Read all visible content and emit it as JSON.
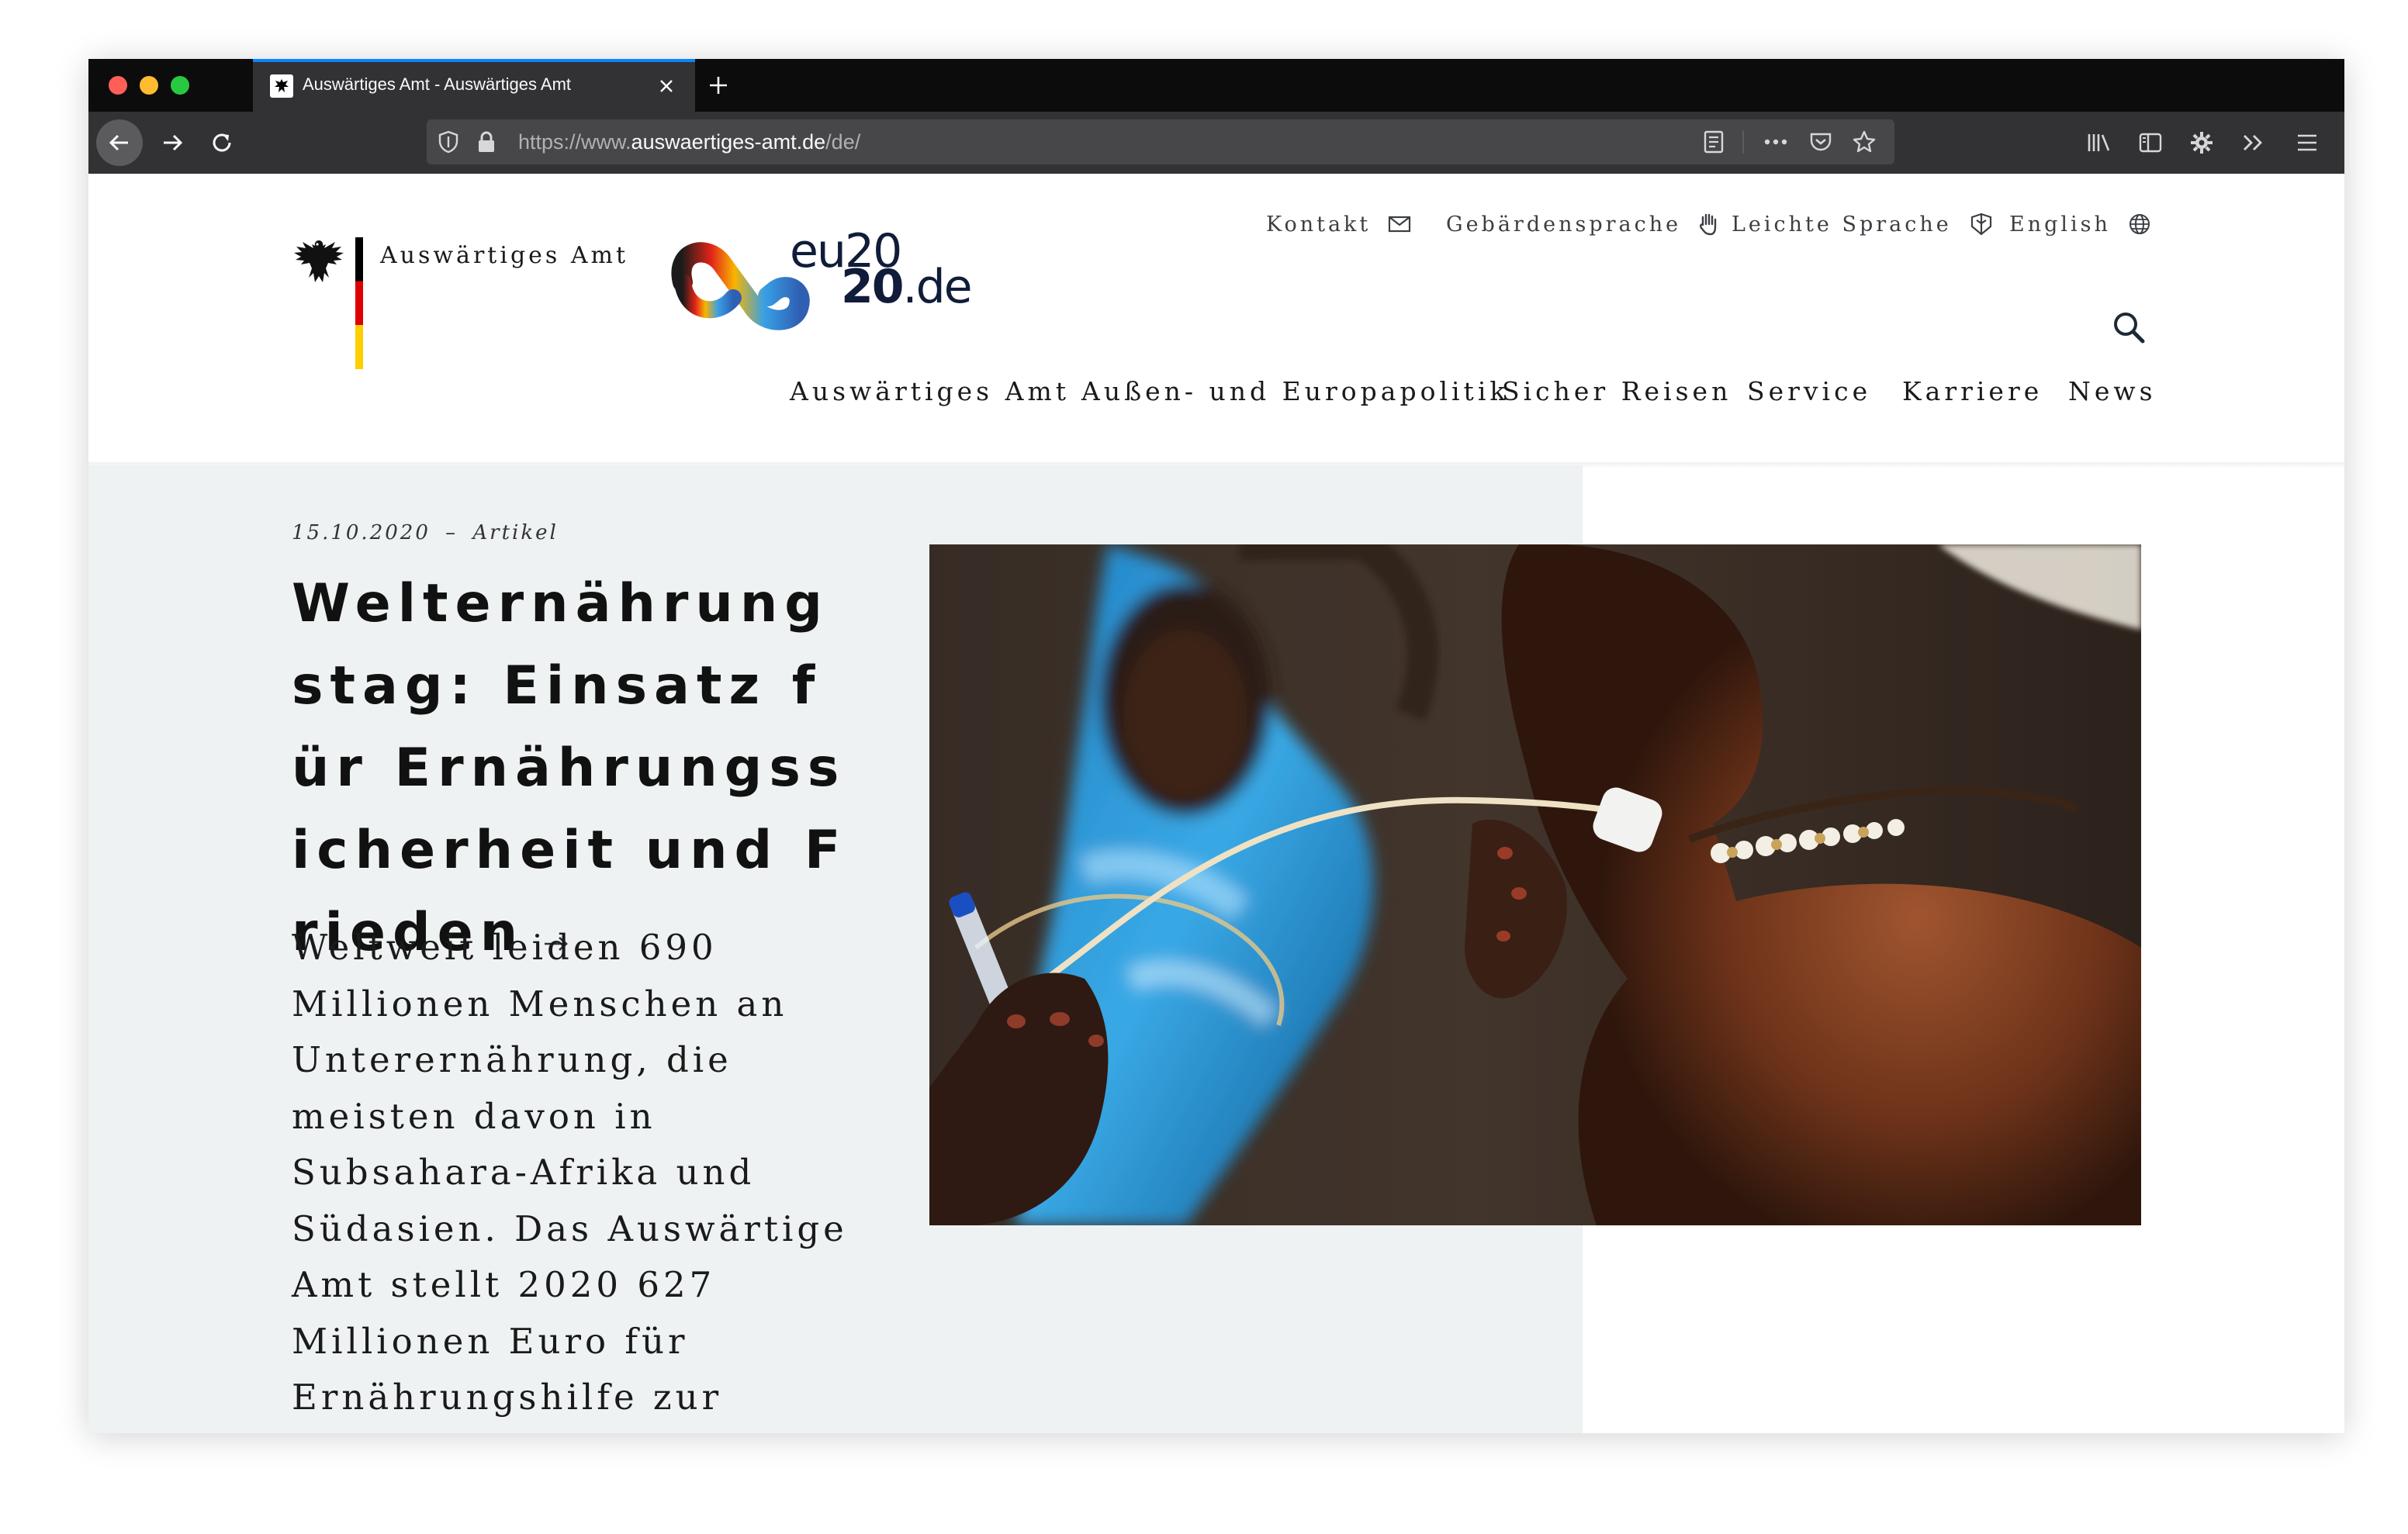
{
  "browser": {
    "tab_title": "Auswärtiges Amt - Auswärtiges Amt",
    "url_prefix": "https://www.",
    "url_host": "auswaertiges-amt.de",
    "url_path": "/de/"
  },
  "site": {
    "ministry_name": "Auswärtiges Amt",
    "eu_logo_line1": "eu20",
    "eu_logo_line2_num": "20",
    "eu_logo_line2_tld": ".de",
    "service_links": [
      {
        "label": "Kontakt",
        "icon": "envelope-icon"
      },
      {
        "label": "Gebärdensprache",
        "icon": "hand-icon"
      },
      {
        "label": "Leichte Sprache",
        "icon": "easy-language-icon"
      },
      {
        "label": "English",
        "icon": "globe-icon"
      }
    ],
    "main_nav": [
      "Auswärtiges Amt",
      "Außen- und Europapolitik",
      "Sicher Reisen",
      "Service",
      "Karriere",
      "News"
    ]
  },
  "teaser": {
    "date": "15.10.2020",
    "separator": "–",
    "category": "Artikel",
    "headline": "Welternährungstag: Einsatz für Ernährungssicherheit und Frieden",
    "lead": "Weltweit leiden 690 Millionen Menschen an Unterernährung, die meisten davon in Subsahara-Afrika und Südasien. Das Auswärtige Amt stellt 2020 627 Millionen Euro für Ernährungshilfe zur"
  },
  "colors": {
    "accent": "#0a84ff",
    "teaser_bg": "#eef2f2",
    "flag_black": "#000000",
    "flag_red": "#dd0000",
    "flag_gold": "#ffce00"
  }
}
